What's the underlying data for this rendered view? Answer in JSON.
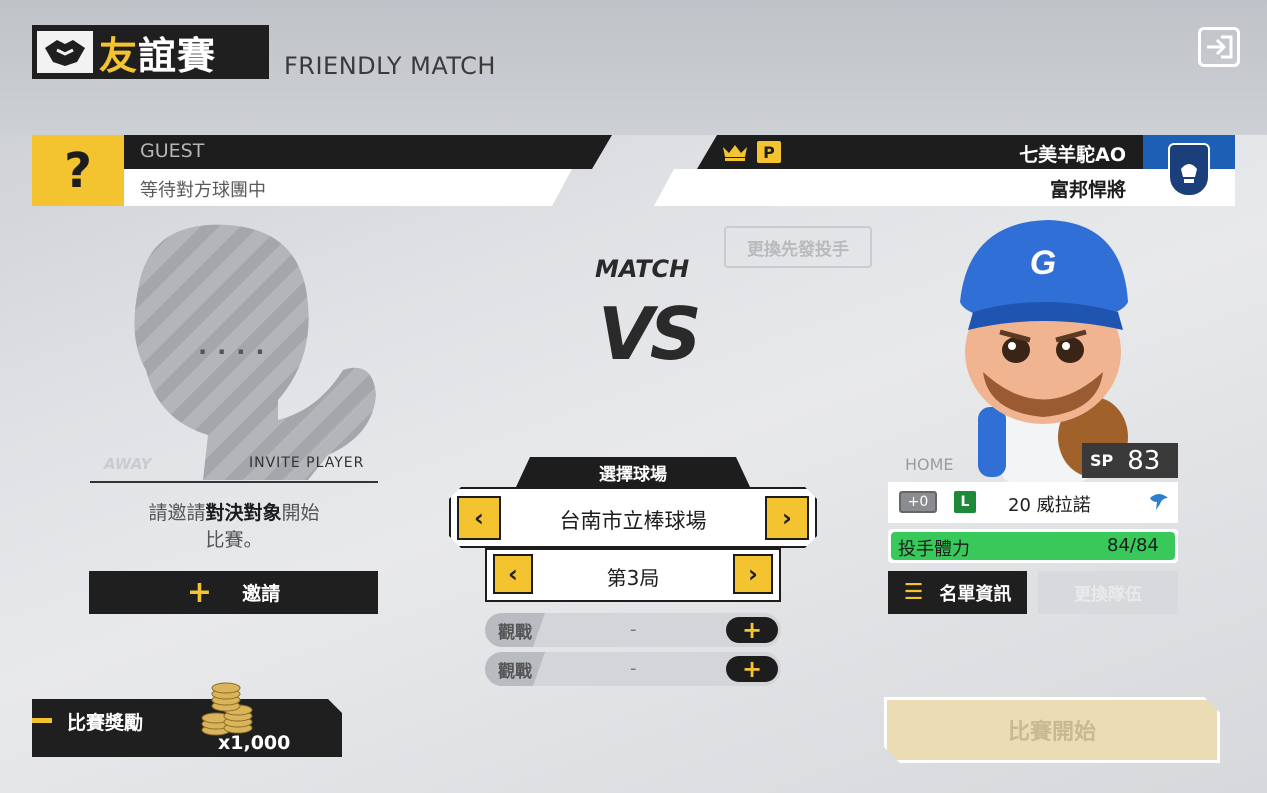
{
  "header": {
    "title_main": "友",
    "title_rest": "誼賽",
    "subtitle": "FRIENDLY MATCH"
  },
  "away": {
    "label": "GUEST",
    "status": "等待對方球團中",
    "placeholder_mark": "?",
    "placeholder_dots": "....",
    "side_label": "AWAY",
    "invite_player": "INVITE PLAYER",
    "invite_msg_pre": "請邀請",
    "invite_msg_bold": "對決對象",
    "invite_msg_post": "開始",
    "invite_msg_line2": "比賽。",
    "invite_button": "邀請"
  },
  "home": {
    "player_name": "七美羊駝AO",
    "team_name": "富邦悍將",
    "badge": "P",
    "side_label": "HOME",
    "pitcher": {
      "position": "SP",
      "overall": "83",
      "boost": "+0",
      "hand": "L",
      "name": "20 威拉諾",
      "stamina_label": "投手體力",
      "stamina_value": "84/84",
      "stamina_fraction": 1.0
    },
    "change_starter": "更換先發投手",
    "roster_button": "名單資訊",
    "swap_button": "更換隊伍"
  },
  "center": {
    "match_label": "MATCH",
    "vs_label": "VS",
    "stadium_header": "選擇球場",
    "stadium": "台南市立棒球場",
    "inning": "第3局",
    "spectators": [
      {
        "tag": "觀戰",
        "value": "-"
      },
      {
        "tag": "觀戰",
        "value": "-"
      }
    ]
  },
  "reward": {
    "label": "比賽獎勵",
    "count": "x1,000"
  },
  "start_button": "比賽開始",
  "colors": {
    "accent": "#f4c430",
    "dark": "#1f1f1f",
    "stamina": "#38c95a",
    "home_blue": "#1d5fb4"
  }
}
